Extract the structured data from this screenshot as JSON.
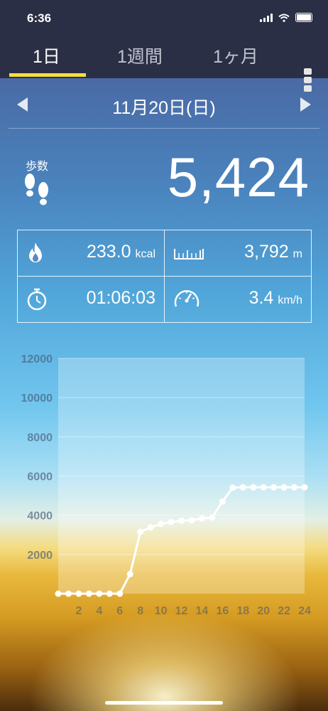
{
  "status_bar": {
    "time": "6:36"
  },
  "tabs": [
    {
      "label": "1日",
      "active": true
    },
    {
      "label": "1週間",
      "active": false
    },
    {
      "label": "1ヶ月",
      "active": false
    }
  ],
  "date": {
    "label": "11月20日(日)"
  },
  "steps": {
    "label": "歩数",
    "value": "5,424"
  },
  "stats": {
    "calories": {
      "value": "233.0",
      "unit": "kcal",
      "icon": "flame-icon"
    },
    "distance": {
      "value": "3,792",
      "unit": "m",
      "icon": "ruler-icon"
    },
    "duration": {
      "value": "01:06:03",
      "icon": "stopwatch-icon"
    },
    "speed": {
      "value": "3.4",
      "unit": "km/h",
      "icon": "speedometer-icon"
    }
  },
  "colors": {
    "tab_underline": "#f5e03a",
    "line": "#ffffff"
  },
  "chart_data": {
    "type": "line",
    "x": [
      0,
      1,
      2,
      3,
      4,
      5,
      6,
      7,
      8,
      9,
      10,
      11,
      12,
      13,
      14,
      15,
      16,
      17,
      18,
      19,
      20,
      21,
      22,
      23,
      24
    ],
    "values": [
      0,
      0,
      0,
      0,
      0,
      0,
      0,
      1000,
      3150,
      3380,
      3560,
      3650,
      3720,
      3740,
      3840,
      3880,
      4700,
      5400,
      5424,
      5424,
      5424,
      5424,
      5424,
      5424,
      5424
    ],
    "xticks": [
      "2",
      "4",
      "6",
      "8",
      "10",
      "12",
      "14",
      "16",
      "18",
      "20",
      "22",
      "24"
    ],
    "yticks": [
      "2000",
      "4000",
      "6000",
      "8000",
      "10000",
      "12000"
    ],
    "ylim": [
      0,
      12000
    ],
    "xlim": [
      0,
      24
    ],
    "grid": true
  }
}
